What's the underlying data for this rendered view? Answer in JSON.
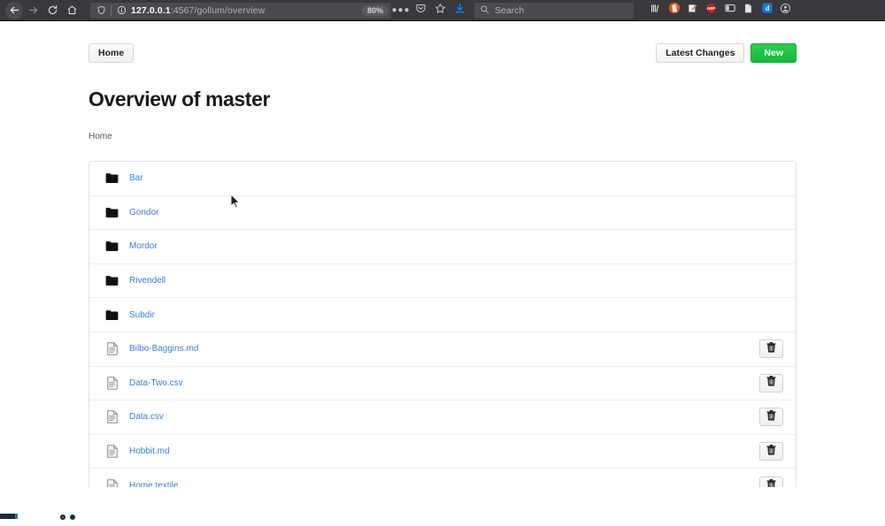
{
  "browser": {
    "back_icon": "back-arrow-icon",
    "forward_icon": "forward-arrow-icon",
    "reload_icon": "reload-icon",
    "home_icon": "home-icon",
    "shield_icon": "shield-icon",
    "info_icon": "info-circle-icon",
    "url_host": "127.0.0.1",
    "url_path": ":4567/gollum/overview",
    "url_full": "127.0.0.1:4567/gollum/overview",
    "zoom_level": "80%",
    "ellipsis_icon": "ellipsis-icon",
    "pocket_icon": "pocket-save-icon",
    "bookmark_icon": "star-bookmark-icon",
    "download_icon": "download-arrow-icon",
    "search_placeholder": "Search",
    "search_icon": "search-icon",
    "extensions": [
      {
        "name": "library-icon",
        "label": "Library"
      },
      {
        "name": "duckduckgo-icon",
        "label": "DuckDuckGo Privacy Essentials"
      },
      {
        "name": "note-pen-icon",
        "label": "Notes"
      },
      {
        "name": "adblock-plus-icon",
        "label": "ABP"
      },
      {
        "name": "sidebar-toggle-icon",
        "label": "Sidebar"
      },
      {
        "name": "reader-document-icon",
        "label": "Reader"
      },
      {
        "name": "dashlane-icon",
        "label": "d"
      },
      {
        "name": "account-avatar-icon",
        "label": "Account"
      }
    ],
    "colors": {
      "chrome_bg": "#38383d",
      "field_bg": "#4b4b4f",
      "text": "#b1b1b3",
      "download_accent": "#0a84ff"
    }
  },
  "page": {
    "home_button": "Home",
    "latest_changes_button": "Latest Changes",
    "new_button": "New",
    "title": "Overview of master",
    "breadcrumb": "Home",
    "colors": {
      "link": "#3b7dd8",
      "new_button_green": "#1cbb43",
      "border": "#e2e2e2"
    },
    "rows": [
      {
        "name": "Bar",
        "type": "folder",
        "icon": "folder-icon",
        "deletable": false
      },
      {
        "name": "Gondor",
        "type": "folder",
        "icon": "folder-icon",
        "deletable": false
      },
      {
        "name": "Mordor",
        "type": "folder",
        "icon": "folder-icon",
        "deletable": false
      },
      {
        "name": "Rivendell",
        "type": "folder",
        "icon": "folder-icon",
        "deletable": false
      },
      {
        "name": "Subdir",
        "type": "folder",
        "icon": "folder-icon",
        "deletable": false
      },
      {
        "name": "Bilbo-Baggins.md",
        "type": "file",
        "icon": "document-icon",
        "deletable": true
      },
      {
        "name": "Data-Two.csv",
        "type": "file",
        "icon": "document-icon",
        "deletable": true
      },
      {
        "name": "Data.csv",
        "type": "file",
        "icon": "document-icon",
        "deletable": true
      },
      {
        "name": "Hobbit.md",
        "type": "file",
        "icon": "document-icon",
        "deletable": true
      },
      {
        "name": "Home.textile",
        "type": "file",
        "icon": "document-icon",
        "deletable": true
      }
    ],
    "delete_icon": "trash-icon",
    "cursor_icon": "mouse-pointer-icon"
  }
}
